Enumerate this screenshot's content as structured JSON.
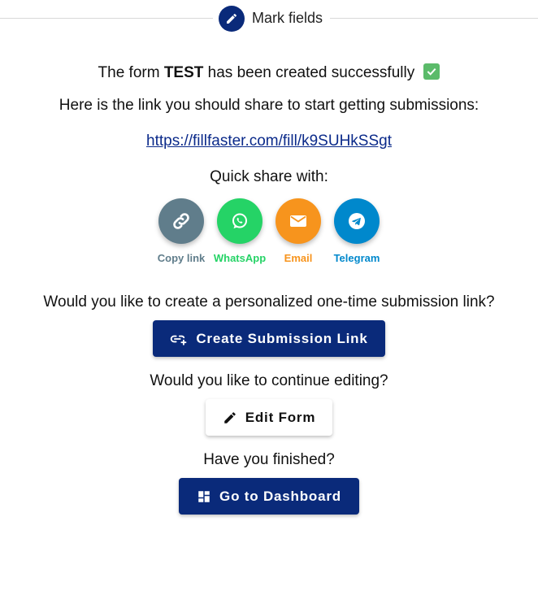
{
  "stepper": {
    "label": "Mark fields",
    "icon": "pencil-icon"
  },
  "success": {
    "prefix": "The form ",
    "form_name": "TEST",
    "suffix": " has been created successfully",
    "icon": "check-box-icon"
  },
  "share_intro": "Here is the link you should share to start getting submissions:",
  "share_url": "https://fillfaster.com/fill/k9SUHkSSgt",
  "quick_share_label": "Quick share with:",
  "share_options": [
    {
      "label": "Copy link",
      "icon": "link-icon",
      "color": "#607d8b"
    },
    {
      "label": "WhatsApp",
      "icon": "whatsapp-icon",
      "color": "#25d366"
    },
    {
      "label": "Email",
      "icon": "email-icon",
      "color": "#f7941d"
    },
    {
      "label": "Telegram",
      "icon": "telegram-icon",
      "color": "#0088cc"
    }
  ],
  "personalized_question": "Would you like to create a personalized one-time submission link?",
  "create_link_button": {
    "label": "Create Submission Link",
    "icon": "link-add-icon"
  },
  "continue_question": "Would you like to continue editing?",
  "edit_form_button": {
    "label": "Edit Form",
    "icon": "pencil-icon"
  },
  "finished_question": "Have you finished?",
  "dashboard_button": {
    "label": "Go to Dashboard",
    "icon": "dashboard-icon"
  },
  "colors": {
    "primary": "#0a2a7a",
    "link": "#0b2a8a"
  }
}
